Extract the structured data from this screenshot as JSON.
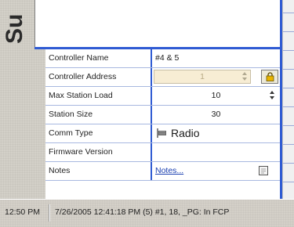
{
  "panel": {
    "title_fragment": "Su"
  },
  "properties": [
    {
      "label": "Controller Name",
      "value": "#4 & 5"
    },
    {
      "label": "Controller Address",
      "value": "1"
    },
    {
      "label": "Max Station Load",
      "value": "10"
    },
    {
      "label": "Station Size",
      "value": "30"
    },
    {
      "label": "Comm Type",
      "value": "Radio",
      "icon": "radio-icon"
    },
    {
      "label": "Firmware Version",
      "value": ""
    },
    {
      "label": "Notes",
      "value": "Notes...",
      "icon": "notes-icon"
    }
  ],
  "statusbar": {
    "time": "12:50 PM",
    "message": "7/26/2005 12:41:18 PM  (5)  #1, 18, _PG: In FCP"
  },
  "colors": {
    "accent": "#2f5bd3",
    "address_field_bg": "#f7edd4",
    "lock_icon": "#d9a400"
  }
}
